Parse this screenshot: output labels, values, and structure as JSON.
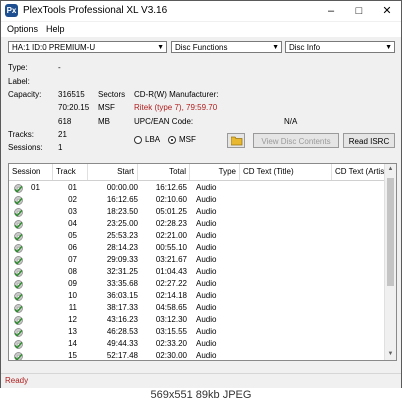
{
  "window": {
    "title": "PlexTools Professional XL V3.16",
    "icon": "plextools-app-icon",
    "icon_glyph": "Px",
    "minimize": "–",
    "maximize": "□",
    "close": "✕"
  },
  "menu": [
    "Options",
    "Help"
  ],
  "toolbar": {
    "drive": "HA:1 ID:0  PREMIUM-U",
    "function": "Disc Functions",
    "view": "Disc Info"
  },
  "info": {
    "type_label": "Type:",
    "type_value": "-",
    "label_label": "Label:",
    "capacity_label": "Capacity:",
    "capacity": [
      {
        "value": "316515",
        "unit": "Sectors"
      },
      {
        "value": "70:20.15",
        "unit": "MSF"
      },
      {
        "value": "618",
        "unit": "MB"
      }
    ],
    "tracks_label": "Tracks:",
    "tracks_value": "21",
    "sessions_label": "Sessions:",
    "sessions_value": "1",
    "manufacturer_label": "CD-R(W) Manufacturer:",
    "manufacturer_value": "Ritek (type 7), 79:59.70",
    "upc_label": "UPC/EAN Code:",
    "upc_value": "N/A",
    "radio_lba": "LBA",
    "radio_msf": "MSF",
    "selected_radio": "MSF",
    "view_contents": "View Disc Contents",
    "read_isrc": "Read ISRC"
  },
  "table": {
    "columns": [
      "Session",
      "Track",
      "Start",
      "Total",
      "Type",
      "CD Text (Title)",
      "CD Text (Artist"
    ],
    "rows": [
      {
        "session": "01",
        "track": "01",
        "start": "00:00.00",
        "total": "16:12.65",
        "type": "Audio"
      },
      {
        "session": "",
        "track": "02",
        "start": "16:12.65",
        "total": "02:10.60",
        "type": "Audio"
      },
      {
        "session": "",
        "track": "03",
        "start": "18:23.50",
        "total": "05:01.25",
        "type": "Audio"
      },
      {
        "session": "",
        "track": "04",
        "start": "23:25.00",
        "total": "02:28.23",
        "type": "Audio"
      },
      {
        "session": "",
        "track": "05",
        "start": "25:53.23",
        "total": "02:21.00",
        "type": "Audio"
      },
      {
        "session": "",
        "track": "06",
        "start": "28:14.23",
        "total": "00:55.10",
        "type": "Audio"
      },
      {
        "session": "",
        "track": "07",
        "start": "29:09.33",
        "total": "03:21.67",
        "type": "Audio"
      },
      {
        "session": "",
        "track": "08",
        "start": "32:31.25",
        "total": "01:04.43",
        "type": "Audio"
      },
      {
        "session": "",
        "track": "09",
        "start": "33:35.68",
        "total": "02:27.22",
        "type": "Audio"
      },
      {
        "session": "",
        "track": "10",
        "start": "36:03.15",
        "total": "02:14.18",
        "type": "Audio"
      },
      {
        "session": "",
        "track": "11",
        "start": "38:17.33",
        "total": "04:58.65",
        "type": "Audio"
      },
      {
        "session": "",
        "track": "12",
        "start": "43:16.23",
        "total": "03:12.30",
        "type": "Audio"
      },
      {
        "session": "",
        "track": "13",
        "start": "46:28.53",
        "total": "03:15.55",
        "type": "Audio"
      },
      {
        "session": "",
        "track": "14",
        "start": "49:44.33",
        "total": "02:33.20",
        "type": "Audio"
      },
      {
        "session": "",
        "track": "15",
        "start": "52:17.48",
        "total": "02:30.00",
        "type": "Audio"
      }
    ]
  },
  "status": "Ready",
  "caption": "569x551 89kb JPEG",
  "colors": {
    "status_text": "#b01d1d",
    "manufacturer_text": "#b01d1d",
    "cd_icon": "#2e8b2e"
  }
}
